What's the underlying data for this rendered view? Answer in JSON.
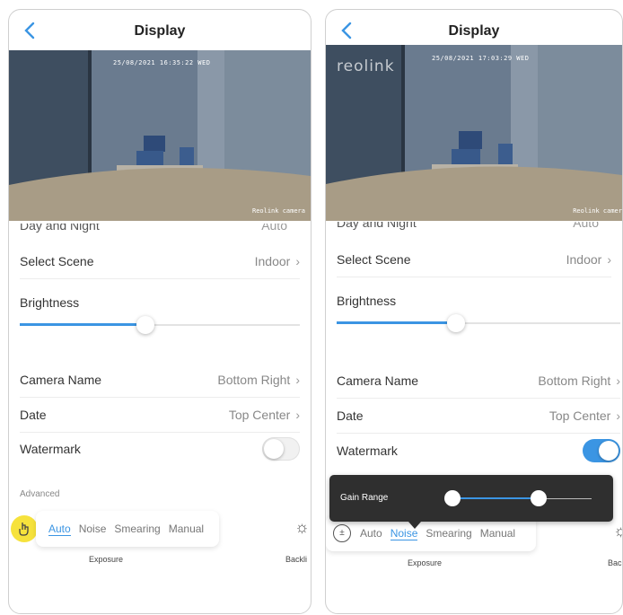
{
  "left": {
    "title": "Display",
    "video": {
      "timestamp": "25/08/2021 16:35:22 WED",
      "camera_label": "Reolink camera"
    },
    "cut_row": {
      "label": "Day and Night",
      "value": "Auto"
    },
    "select_scene": {
      "label": "Select Scene",
      "value": "Indoor"
    },
    "brightness": {
      "label": "Brightness",
      "level": 0.45
    },
    "camera_name": {
      "label": "Camera Name",
      "value": "Bottom Right"
    },
    "date": {
      "label": "Date",
      "value": "Top Center"
    },
    "watermark": {
      "label": "Watermark",
      "on": false
    },
    "advanced_label": "Advanced",
    "exposure_options": [
      "Auto",
      "Noise",
      "Smearing",
      "Manual"
    ],
    "exposure_selected": "Auto",
    "exposure_label": "Exposure",
    "side_label": "Backli"
  },
  "right": {
    "title": "Display",
    "video": {
      "timestamp": "25/08/2021 17:03:29 WED",
      "camera_label": "Reolink camer",
      "logo": "reolink"
    },
    "cut_row": {
      "label": "Day and Night",
      "value": "Auto"
    },
    "select_scene": {
      "label": "Select Scene",
      "value": "Indoor"
    },
    "brightness": {
      "label": "Brightness",
      "level": 0.42
    },
    "camera_name": {
      "label": "Camera Name",
      "value": "Bottom Right"
    },
    "date": {
      "label": "Date",
      "value": "Top Center"
    },
    "watermark": {
      "label": "Watermark",
      "on": true
    },
    "gain_range": {
      "label": "Gain Range",
      "low": 0.0,
      "high": 0.6
    },
    "exposure_options": [
      "Auto",
      "Noise",
      "Smearing",
      "Manual"
    ],
    "exposure_selected": "Noise",
    "exposure_label": "Exposure",
    "side_label": "Bac"
  },
  "chevron": "›",
  "colors": {
    "accent": "#3b95e3",
    "cursor_highlight": "#f6e23c"
  }
}
